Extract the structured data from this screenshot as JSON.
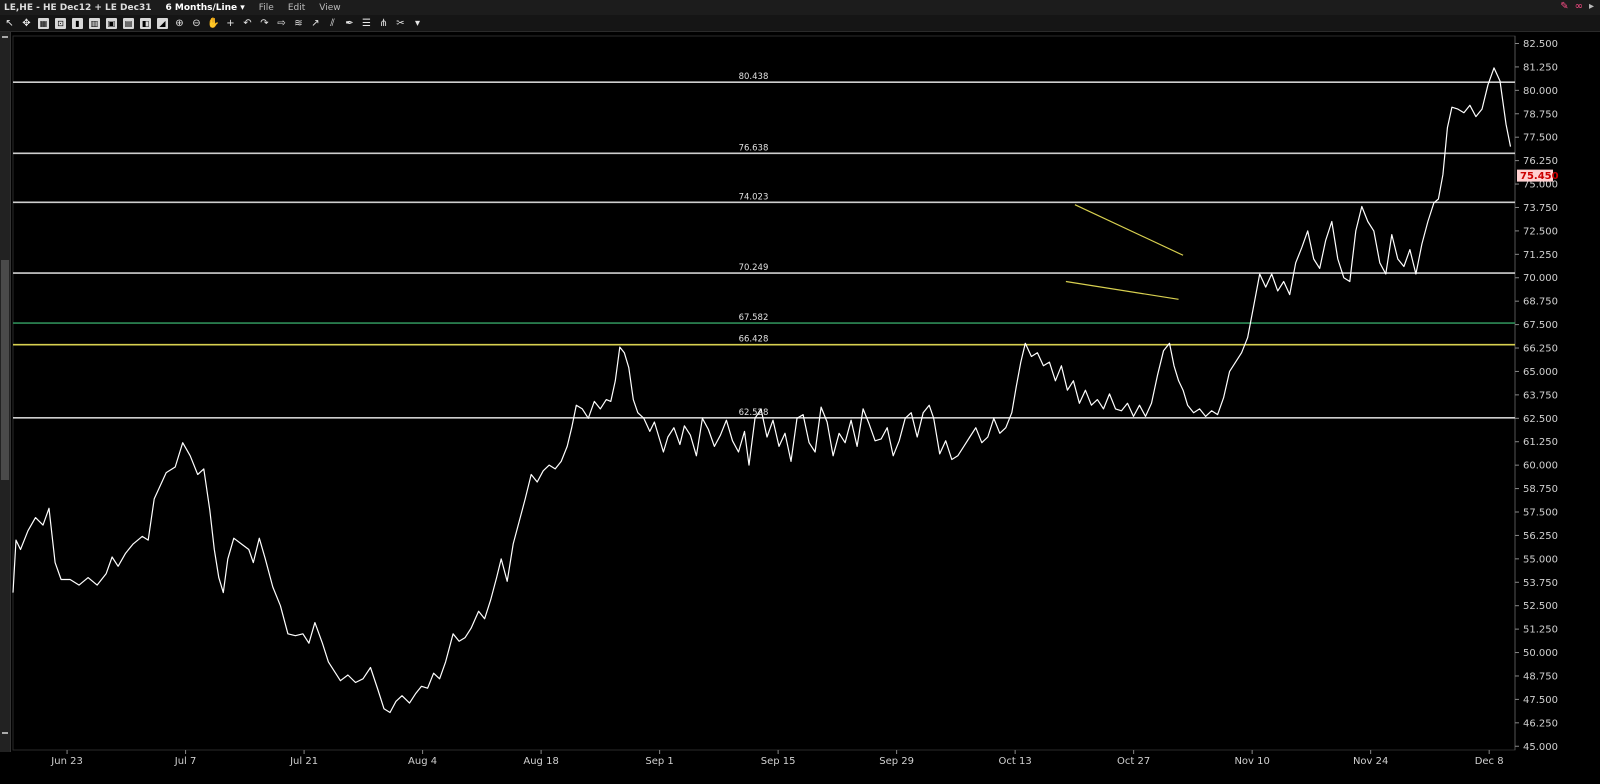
{
  "window": {
    "title": "LE,HE - HE Dec12 + LE Dec31",
    "period": "6 Months/Line ▾",
    "menus": [
      "File",
      "Edit",
      "View"
    ]
  },
  "toolbar_icons": [
    "arrow-icon",
    "crosshair-icon",
    "grid-icon",
    "zoom-box-icon",
    "bar-chart-icon",
    "candlestick-icon",
    "image-icon",
    "layout-icon",
    "indicator-icon",
    "draw-icon",
    "zoom-in-icon",
    "zoom-out-icon",
    "hand-icon",
    "cross-icon",
    "undo-icon",
    "redo-icon",
    "next-icon",
    "fibonacci-icon",
    "trend-icon",
    "channel-icon",
    "pen-icon",
    "lines-icon",
    "pitchfork-icon",
    "tool-icon",
    "dropdown-icon"
  ],
  "colors": {
    "background": "#000000",
    "price_line": "#ffffff",
    "level_line": "#cfcfcf",
    "green_level": "#2e8b57",
    "yellow_level": "#d8d050",
    "trendline": "#d8d050",
    "last_price_bg": "#ffd0d0",
    "last_price_fg": "#cc0000"
  },
  "chart_data": {
    "type": "line",
    "ylim": [
      44.8,
      82.9
    ],
    "y_ticks": [
      "82.500",
      "81.250",
      "80.000",
      "78.750",
      "77.500",
      "76.250",
      "75.000",
      "73.750",
      "72.500",
      "71.250",
      "70.000",
      "68.750",
      "67.500",
      "66.250",
      "65.000",
      "63.750",
      "62.500",
      "61.250",
      "60.000",
      "58.750",
      "57.500",
      "56.250",
      "55.000",
      "53.750",
      "52.500",
      "51.250",
      "50.000",
      "48.750",
      "47.500",
      "46.250",
      "45.000"
    ],
    "x_labels": [
      "Jun 23",
      "Jul 7",
      "Jul 21",
      "Aug 4",
      "Aug 18",
      "Sep 1",
      "Sep 15",
      "Sep 29",
      "Oct 13",
      "Oct 27",
      "Nov 10",
      "Nov 24",
      "Dec 8"
    ],
    "last_price": "75.450",
    "levels": [
      {
        "label": "80.438",
        "value": 80.438,
        "color": "#cfcfcf"
      },
      {
        "label": "76.638",
        "value": 76.638,
        "color": "#cfcfcf"
      },
      {
        "label": "74.023",
        "value": 74.023,
        "color": "#cfcfcf"
      },
      {
        "label": "70.249",
        "value": 70.249,
        "color": "#cfcfcf"
      },
      {
        "label": "67.582",
        "value": 67.582,
        "color": "#2e8b57"
      },
      {
        "label": "66.428",
        "value": 66.428,
        "color": "#d8d050"
      },
      {
        "label": "62.528",
        "value": 62.528,
        "color": "#cfcfcf"
      }
    ],
    "trendlines": [
      {
        "t0": 0.707,
        "v0": 73.9,
        "t1": 0.779,
        "v1": 71.2
      },
      {
        "t0": 0.701,
        "v0": 69.8,
        "t1": 0.776,
        "v1": 68.85
      }
    ],
    "series": [
      {
        "points": [
          [
            0.0,
            53.2
          ],
          [
            0.002,
            56.0
          ],
          [
            0.005,
            55.5
          ],
          [
            0.01,
            56.5
          ],
          [
            0.015,
            57.2
          ],
          [
            0.02,
            56.8
          ],
          [
            0.024,
            57.7
          ],
          [
            0.028,
            54.8
          ],
          [
            0.032,
            53.9
          ],
          [
            0.038,
            53.9
          ],
          [
            0.044,
            53.6
          ],
          [
            0.05,
            54.0
          ],
          [
            0.056,
            53.6
          ],
          [
            0.062,
            54.2
          ],
          [
            0.066,
            55.1
          ],
          [
            0.07,
            54.6
          ],
          [
            0.075,
            55.3
          ],
          [
            0.08,
            55.8
          ],
          [
            0.086,
            56.2
          ],
          [
            0.09,
            56.0
          ],
          [
            0.094,
            58.2
          ],
          [
            0.098,
            58.9
          ],
          [
            0.102,
            59.6
          ],
          [
            0.108,
            59.9
          ],
          [
            0.113,
            61.2
          ],
          [
            0.118,
            60.5
          ],
          [
            0.123,
            59.5
          ],
          [
            0.127,
            59.8
          ],
          [
            0.131,
            57.6
          ],
          [
            0.134,
            55.5
          ],
          [
            0.137,
            54.0
          ],
          [
            0.14,
            53.2
          ],
          [
            0.143,
            55.0
          ],
          [
            0.147,
            56.1
          ],
          [
            0.152,
            55.8
          ],
          [
            0.157,
            55.5
          ],
          [
            0.16,
            54.8
          ],
          [
            0.164,
            56.1
          ],
          [
            0.168,
            55.0
          ],
          [
            0.173,
            53.5
          ],
          [
            0.178,
            52.5
          ],
          [
            0.183,
            51.0
          ],
          [
            0.188,
            50.9
          ],
          [
            0.193,
            51.0
          ],
          [
            0.197,
            50.5
          ],
          [
            0.201,
            51.6
          ],
          [
            0.206,
            50.5
          ],
          [
            0.21,
            49.5
          ],
          [
            0.214,
            49.0
          ],
          [
            0.218,
            48.5
          ],
          [
            0.223,
            48.8
          ],
          [
            0.228,
            48.4
          ],
          [
            0.233,
            48.6
          ],
          [
            0.238,
            49.2
          ],
          [
            0.243,
            48.0
          ],
          [
            0.247,
            47.0
          ],
          [
            0.251,
            46.8
          ],
          [
            0.255,
            47.4
          ],
          [
            0.259,
            47.7
          ],
          [
            0.264,
            47.3
          ],
          [
            0.268,
            47.8
          ],
          [
            0.272,
            48.2
          ],
          [
            0.276,
            48.1
          ],
          [
            0.28,
            48.9
          ],
          [
            0.284,
            48.6
          ],
          [
            0.288,
            49.5
          ],
          [
            0.293,
            51.0
          ],
          [
            0.297,
            50.6
          ],
          [
            0.301,
            50.8
          ],
          [
            0.305,
            51.3
          ],
          [
            0.31,
            52.2
          ],
          [
            0.314,
            51.8
          ],
          [
            0.318,
            52.8
          ],
          [
            0.322,
            54.0
          ],
          [
            0.325,
            55.0
          ],
          [
            0.329,
            53.8
          ],
          [
            0.333,
            55.8
          ],
          [
            0.337,
            57.0
          ],
          [
            0.341,
            58.2
          ],
          [
            0.345,
            59.5
          ],
          [
            0.349,
            59.1
          ],
          [
            0.353,
            59.7
          ],
          [
            0.357,
            60.0
          ],
          [
            0.361,
            59.8
          ],
          [
            0.365,
            60.2
          ],
          [
            0.369,
            61.0
          ],
          [
            0.372,
            62.0
          ],
          [
            0.375,
            63.2
          ],
          [
            0.379,
            63.0
          ],
          [
            0.383,
            62.5
          ],
          [
            0.387,
            63.4
          ],
          [
            0.391,
            63.0
          ],
          [
            0.395,
            63.5
          ],
          [
            0.398,
            63.4
          ],
          [
            0.401,
            64.5
          ],
          [
            0.404,
            66.3
          ],
          [
            0.407,
            66.0
          ],
          [
            0.41,
            65.2
          ],
          [
            0.413,
            63.5
          ],
          [
            0.416,
            62.8
          ],
          [
            0.42,
            62.5
          ],
          [
            0.424,
            61.8
          ],
          [
            0.427,
            62.3
          ],
          [
            0.43,
            61.5
          ],
          [
            0.433,
            60.7
          ],
          [
            0.436,
            61.5
          ],
          [
            0.44,
            62.0
          ],
          [
            0.444,
            61.1
          ],
          [
            0.447,
            62.1
          ],
          [
            0.451,
            61.6
          ],
          [
            0.455,
            60.5
          ],
          [
            0.459,
            62.5
          ],
          [
            0.463,
            61.9
          ],
          [
            0.467,
            61.0
          ],
          [
            0.471,
            61.6
          ],
          [
            0.475,
            62.4
          ],
          [
            0.479,
            61.3
          ],
          [
            0.483,
            60.7
          ],
          [
            0.487,
            61.8
          ],
          [
            0.49,
            60.0
          ],
          [
            0.494,
            62.5
          ],
          [
            0.498,
            63.0
          ],
          [
            0.502,
            61.5
          ],
          [
            0.506,
            62.4
          ],
          [
            0.51,
            61.0
          ],
          [
            0.514,
            61.7
          ],
          [
            0.518,
            60.2
          ],
          [
            0.522,
            62.5
          ],
          [
            0.526,
            62.7
          ],
          [
            0.53,
            61.2
          ],
          [
            0.534,
            60.7
          ],
          [
            0.538,
            63.1
          ],
          [
            0.542,
            62.3
          ],
          [
            0.546,
            60.5
          ],
          [
            0.55,
            61.7
          ],
          [
            0.554,
            61.2
          ],
          [
            0.558,
            62.4
          ],
          [
            0.562,
            61.0
          ],
          [
            0.566,
            63.0
          ],
          [
            0.57,
            62.2
          ],
          [
            0.574,
            61.3
          ],
          [
            0.578,
            61.4
          ],
          [
            0.582,
            62.0
          ],
          [
            0.586,
            60.5
          ],
          [
            0.59,
            61.3
          ],
          [
            0.594,
            62.5
          ],
          [
            0.598,
            62.8
          ],
          [
            0.602,
            61.5
          ],
          [
            0.606,
            62.8
          ],
          [
            0.61,
            63.2
          ],
          [
            0.613,
            62.5
          ],
          [
            0.617,
            60.6
          ],
          [
            0.621,
            61.3
          ],
          [
            0.625,
            60.3
          ],
          [
            0.629,
            60.5
          ],
          [
            0.633,
            61.0
          ],
          [
            0.637,
            61.5
          ],
          [
            0.641,
            62.0
          ],
          [
            0.645,
            61.2
          ],
          [
            0.649,
            61.5
          ],
          [
            0.653,
            62.5
          ],
          [
            0.657,
            61.7
          ],
          [
            0.661,
            62.0
          ],
          [
            0.665,
            62.8
          ],
          [
            0.668,
            64.2
          ],
          [
            0.671,
            65.5
          ],
          [
            0.674,
            66.5
          ],
          [
            0.678,
            65.8
          ],
          [
            0.682,
            66.0
          ],
          [
            0.686,
            65.3
          ],
          [
            0.69,
            65.5
          ],
          [
            0.694,
            64.5
          ],
          [
            0.698,
            65.3
          ],
          [
            0.702,
            64.0
          ],
          [
            0.706,
            64.5
          ],
          [
            0.71,
            63.3
          ],
          [
            0.714,
            64.0
          ],
          [
            0.718,
            63.2
          ],
          [
            0.722,
            63.5
          ],
          [
            0.726,
            63.0
          ],
          [
            0.73,
            63.8
          ],
          [
            0.734,
            63.0
          ],
          [
            0.738,
            62.9
          ],
          [
            0.742,
            63.3
          ],
          [
            0.746,
            62.6
          ],
          [
            0.75,
            63.2
          ],
          [
            0.754,
            62.6
          ],
          [
            0.758,
            63.3
          ],
          [
            0.762,
            64.8
          ],
          [
            0.766,
            66.1
          ],
          [
            0.77,
            66.5
          ],
          [
            0.773,
            65.3
          ],
          [
            0.776,
            64.5
          ],
          [
            0.779,
            64.0
          ],
          [
            0.782,
            63.2
          ],
          [
            0.786,
            62.8
          ],
          [
            0.79,
            63.0
          ],
          [
            0.794,
            62.6
          ],
          [
            0.798,
            62.9
          ],
          [
            0.802,
            62.7
          ],
          [
            0.806,
            63.6
          ],
          [
            0.81,
            65.0
          ],
          [
            0.814,
            65.5
          ],
          [
            0.818,
            66.0
          ],
          [
            0.822,
            66.8
          ],
          [
            0.826,
            68.5
          ],
          [
            0.83,
            70.2
          ],
          [
            0.834,
            69.5
          ],
          [
            0.838,
            70.2
          ],
          [
            0.842,
            69.3
          ],
          [
            0.846,
            69.8
          ],
          [
            0.85,
            69.1
          ],
          [
            0.854,
            70.8
          ],
          [
            0.858,
            71.6
          ],
          [
            0.862,
            72.5
          ],
          [
            0.866,
            71.0
          ],
          [
            0.87,
            70.5
          ],
          [
            0.874,
            72.0
          ],
          [
            0.878,
            73.0
          ],
          [
            0.882,
            71.0
          ],
          [
            0.886,
            70.0
          ],
          [
            0.89,
            69.8
          ],
          [
            0.894,
            72.5
          ],
          [
            0.898,
            73.8
          ],
          [
            0.902,
            73.0
          ],
          [
            0.906,
            72.5
          ],
          [
            0.91,
            70.8
          ],
          [
            0.914,
            70.2
          ],
          [
            0.918,
            72.3
          ],
          [
            0.922,
            71.0
          ],
          [
            0.926,
            70.6
          ],
          [
            0.93,
            71.5
          ],
          [
            0.934,
            70.2
          ],
          [
            0.938,
            71.8
          ],
          [
            0.942,
            73.0
          ],
          [
            0.946,
            74.0
          ],
          [
            0.949,
            74.2
          ],
          [
            0.952,
            75.5
          ],
          [
            0.955,
            78.0
          ],
          [
            0.958,
            79.1
          ],
          [
            0.962,
            79.0
          ],
          [
            0.966,
            78.8
          ],
          [
            0.97,
            79.2
          ],
          [
            0.974,
            78.6
          ],
          [
            0.978,
            79.0
          ],
          [
            0.982,
            80.3
          ],
          [
            0.986,
            81.2
          ],
          [
            0.99,
            80.5
          ],
          [
            0.994,
            78.2
          ],
          [
            0.997,
            77.0
          ]
        ]
      }
    ]
  }
}
